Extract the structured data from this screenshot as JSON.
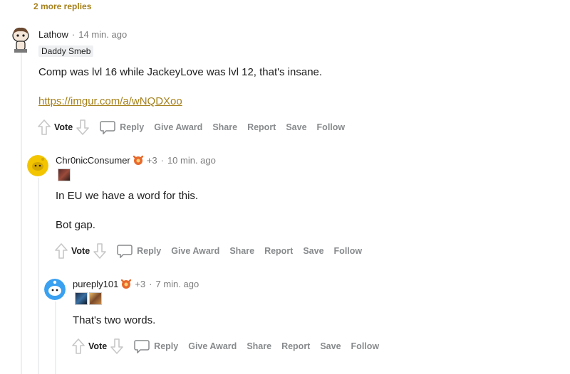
{
  "top": {
    "more_replies": "2 more replies"
  },
  "comments": [
    {
      "author": "Lathow",
      "time": "14 min. ago",
      "flair": "Daddy Smeb",
      "paragraphs": [
        "Comp was lvl 16 while JackeyLove was lvl 12, that's insane."
      ],
      "link": "https://imgur.com/a/wNQDXoo"
    },
    {
      "author": "Chr0nicConsumer",
      "award_count": "+3",
      "time": "10 min. ago",
      "paragraphs": [
        "In EU we have a word for this.",
        "Bot gap."
      ]
    },
    {
      "author": "pureply101",
      "award_count": "+3",
      "time": "7 min. ago",
      "paragraphs": [
        "That's two words."
      ]
    }
  ],
  "actions": {
    "vote": "Vote",
    "reply": "Reply",
    "give_award": "Give Award",
    "share": "Share",
    "report": "Report",
    "save": "Save",
    "follow": "Follow"
  },
  "colors": {
    "accent": "#a5801a",
    "muted": "#878a8c",
    "line": "#edeff1"
  }
}
